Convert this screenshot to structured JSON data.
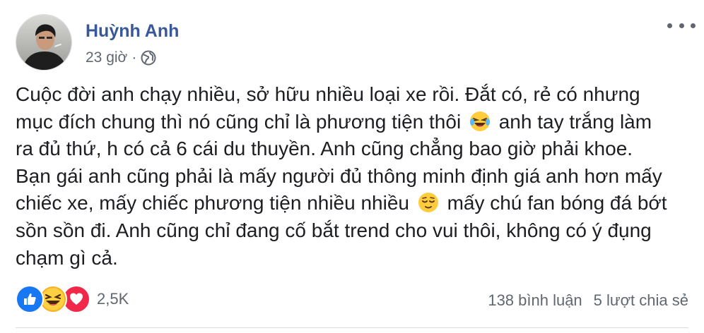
{
  "post": {
    "author_name": "Huỳnh Anh",
    "timestamp": "23 giờ",
    "separator": "·",
    "privacy_icon": "globe-icon",
    "more_icon": "more-options-icon",
    "text_lines": [
      "Cuộc đời anh chạy nhiều, sở hữu nhiều loại xe rồi. Đắt có, rẻ có nhưng",
      [
        "mục đích chung thì nó cũng chỉ là phương tiện thôi",
        " anh tay trắng làm"
      ],
      "ra đủ thứ, h có cả 6 cái du thuyền. Anh cũng chẳng bao giờ phải khoe.",
      "Bạn gái anh cũng phải là mấy người đủ thông minh định giá anh hơn mấy",
      [
        "chiếc xe, mấy chiếc phương tiện nhiều nhiều",
        " mấy chú fan bóng đá bớt"
      ],
      "sồn sồn đi. Anh cũng chỉ đang cố bắt trend cho vui thôi, không có ý đụng",
      "chạm gì cả."
    ],
    "inline_emojis": [
      "laughing-tears-emoji",
      "relieved-face-emoji"
    ]
  },
  "footer": {
    "reaction_icons": [
      "like-reaction-icon",
      "haha-reaction-icon",
      "love-reaction-icon"
    ],
    "reaction_count": "2,5K",
    "comments": "138 bình luận",
    "shares": "5 lượt chia sẻ"
  },
  "colors": {
    "name": "#385898",
    "secondary_text": "#606770",
    "like": "#1877f2",
    "haha": "#f7b125",
    "love": "#f0284a"
  }
}
